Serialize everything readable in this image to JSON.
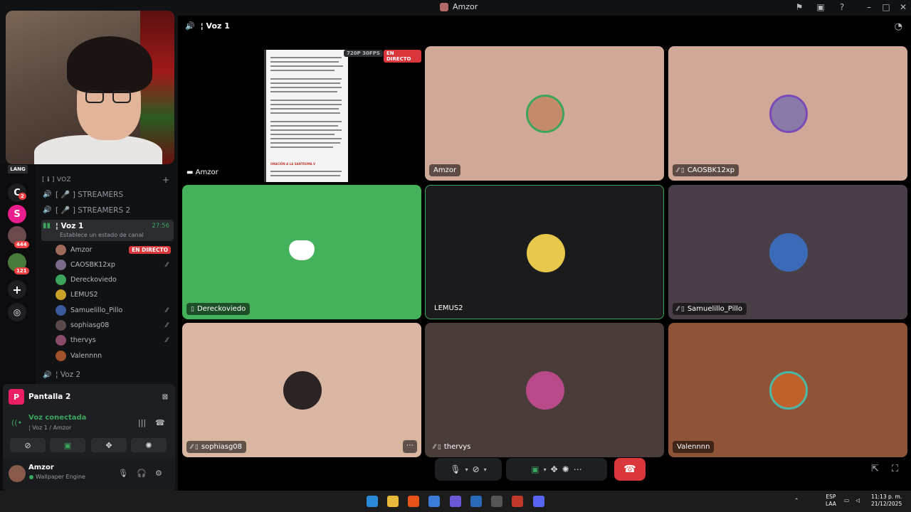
{
  "window": {
    "title": "Amzor"
  },
  "sidebar": {
    "category": "[ ℹ ] VOZ",
    "channels": [
      {
        "name": "[ 🎤 ] STREAMERS"
      },
      {
        "name": "[ 🎤 ] STREAMERS 2"
      },
      {
        "name": "¦ Voz 1",
        "time": "27:56",
        "status": "Establece un estado de canal"
      },
      {
        "name": "¦ Voz 2"
      }
    ],
    "users": [
      {
        "name": "Amzor",
        "badge": "EN DIRECTO",
        "color": "#a06a5a"
      },
      {
        "name": "CAOSBK12xp",
        "color": "#7a6a8a"
      },
      {
        "name": "Dereckoviedo",
        "color": "#3ba55c"
      },
      {
        "name": "LEMUS2",
        "color": "#c9a227"
      },
      {
        "name": "Samuelillo_Pillo",
        "color": "#3a5a9a"
      },
      {
        "name": "sophiasg08",
        "color": "#5a4a4a"
      },
      {
        "name": "thervys",
        "color": "#8a4a6a"
      },
      {
        "name": "Valennnn",
        "color": "#a0522d"
      }
    ]
  },
  "rail_badges": [
    "2",
    "444",
    "121"
  ],
  "panel": {
    "screen_label": "Pantalla 2",
    "voice_status": "Voz conectada",
    "voice_sub": "¦ Voz 1 / Amzor",
    "username": "Amzor",
    "activity": "Wallpaper Engine"
  },
  "main": {
    "header": "¦ Voz 1",
    "stream": {
      "user": "Amzor",
      "quality": "720P 30FPS",
      "live": "EN DIRECTO",
      "doc_heading": "ORACIÓN A LA SANTÍSIMA V"
    },
    "tiles": [
      {
        "name": "Amzor",
        "bg": "#d0a898"
      },
      {
        "name": "CAOSBK12xp",
        "bg": "#d0a898"
      },
      {
        "name": "Dereckoviedo",
        "bg": "#43b25a"
      },
      {
        "name": "LEMUS2",
        "bg": "#1b1b1d"
      },
      {
        "name": "Samuelillo_Pillo",
        "bg": "#4a3f48"
      },
      {
        "name": "sophiasg08",
        "bg": "#d8b6a2"
      },
      {
        "name": "thervys",
        "bg": "#4a3c38"
      },
      {
        "name": "Valennnn",
        "bg": "#8f5338"
      }
    ]
  },
  "taskbar": {
    "lang1": "ESP",
    "lang2": "LAA",
    "time": "11:13 p. m.",
    "date": "21/12/2025"
  }
}
